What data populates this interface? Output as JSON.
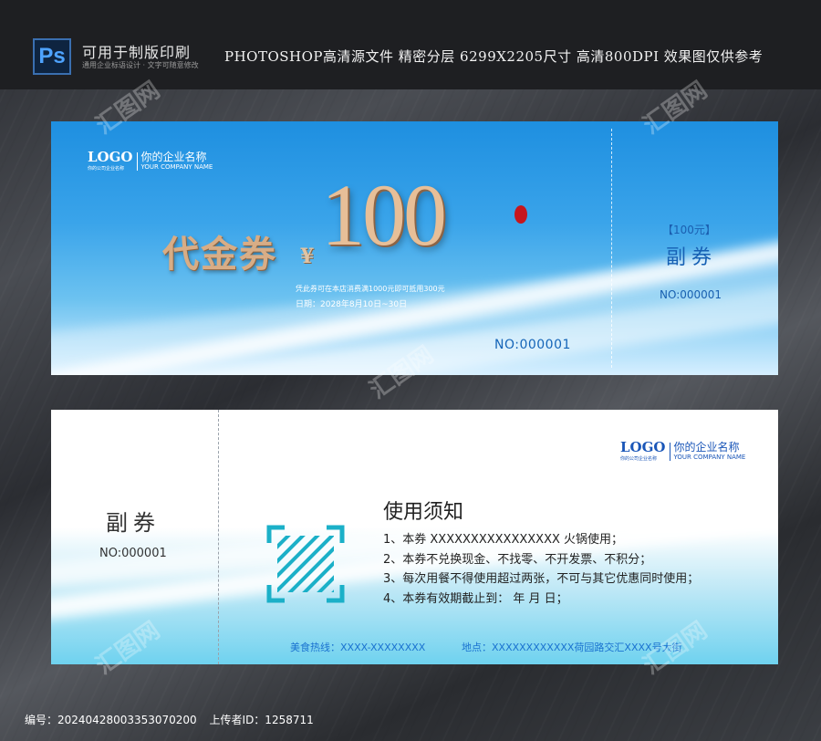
{
  "header": {
    "app_badge": "Ps",
    "title": "可用于制版印刷",
    "subtitle": "通用企业标语设计 · 文字可随意修改",
    "info": "PHOTOSHOP高清源文件 精密分层 6299X2205尺寸 高清800DPI 效果图仅供参考"
  },
  "ticket_front": {
    "logo_word": "LOGO",
    "logo_small": "你的公司企业名称",
    "company_name": "你的企业名称",
    "company_name_en": "YOUR COMPANY NAME",
    "title": "代金券",
    "currency": "¥",
    "amount": "100",
    "terms": "凭此券可在本店消费满1000元即可抵用300元",
    "date": "日期：2028年8月10日~30日",
    "serial": "NO:000001",
    "stub_value": "【100元】",
    "stub_label": "副券",
    "stub_serial": "NO:000001"
  },
  "ticket_back": {
    "stub_label": "副券",
    "stub_serial": "NO:000001",
    "logo_word": "LOGO",
    "logo_small": "你的公司企业名称",
    "company_name": "你的企业名称",
    "company_name_en": "YOUR COMPANY NAME",
    "notice_title": "使用须知",
    "notice_items": [
      "1、本券 XXXXXXXXXXXXXXXX 火锅使用；",
      "2、本券不兑换现金、不找零、不开发票、不积分；",
      "3、每次用餐不得使用超过两张，不可与其它优惠同时使用；",
      "4、本券有效期截止到：        年      月      日；"
    ],
    "hotline": "美食热线：XXXX-XXXXXXXX",
    "address": "地点：XXXXXXXXXXXX荷园路交汇XXXX号大街"
  },
  "watermark_text": "汇图网",
  "footer": {
    "id_text": "编号：20240428003353070200",
    "uploader_text": "上传者ID：1258711"
  },
  "colors": {
    "primary_blue": "#1e8fe0",
    "gold": "#d8ad86",
    "seal_red": "#c6161d"
  }
}
